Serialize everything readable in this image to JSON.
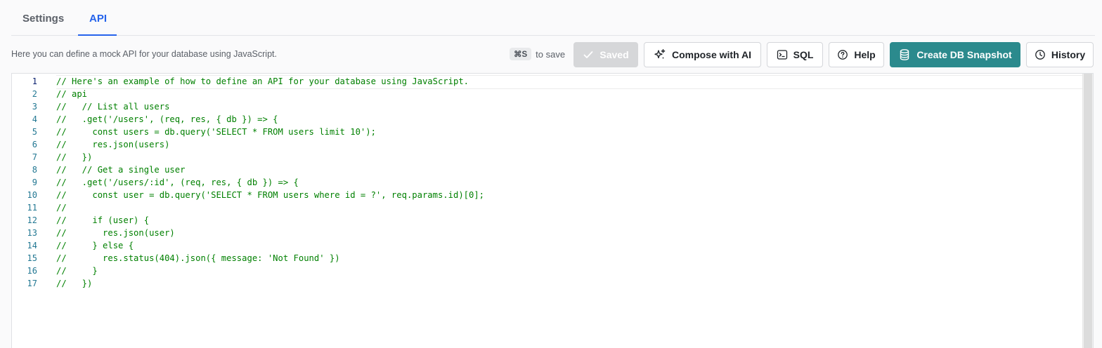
{
  "tabs": [
    {
      "label": "Settings"
    },
    {
      "label": "API"
    }
  ],
  "description": "Here you can define a mock API for your database using JavaScript.",
  "save_hint": {
    "shortcut": "⌘S",
    "text": "to save"
  },
  "toolbar": {
    "saved_label": "Saved",
    "compose_label": "Compose with AI",
    "sql_label": "SQL",
    "help_label": "Help",
    "snapshot_label": "Create DB Snapshot",
    "history_label": "History"
  },
  "colors": {
    "accent": "#2563eb",
    "primary_button": "#2b8a8d",
    "code_comment": "#008000"
  },
  "editor": {
    "active_line": 1,
    "lines": [
      {
        "n": "1",
        "text": "// Here's an example of how to define an API for your database using JavaScript."
      },
      {
        "n": "2",
        "text": "// api"
      },
      {
        "n": "3",
        "text": "//   // List all users"
      },
      {
        "n": "4",
        "text": "//   .get('/users', (req, res, { db }) => {"
      },
      {
        "n": "5",
        "text": "//     const users = db.query('SELECT * FROM users limit 10');"
      },
      {
        "n": "6",
        "text": "//     res.json(users)"
      },
      {
        "n": "7",
        "text": "//   })"
      },
      {
        "n": "8",
        "text": "//   // Get a single user"
      },
      {
        "n": "9",
        "text": "//   .get('/users/:id', (req, res, { db }) => {"
      },
      {
        "n": "10",
        "text": "//     const user = db.query('SELECT * FROM users where id = ?', req.params.id)[0];"
      },
      {
        "n": "11",
        "text": "//"
      },
      {
        "n": "12",
        "text": "//     if (user) {"
      },
      {
        "n": "13",
        "text": "//       res.json(user)"
      },
      {
        "n": "14",
        "text": "//     } else {"
      },
      {
        "n": "15",
        "text": "//       res.status(404).json({ message: 'Not Found' })"
      },
      {
        "n": "16",
        "text": "//     }"
      },
      {
        "n": "17",
        "text": "//   })"
      }
    ]
  }
}
